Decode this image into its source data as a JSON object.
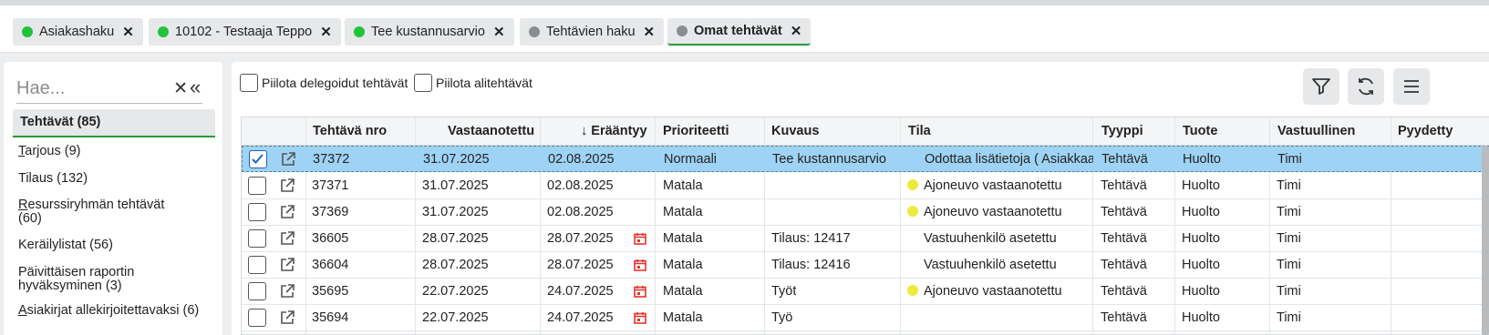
{
  "tabs": [
    {
      "label": "Asiakashaku",
      "dot": "green"
    },
    {
      "label": "10102 - Testaaja Teppo",
      "dot": "green"
    },
    {
      "label": "Tee kustannusarvio",
      "dot": "green"
    },
    {
      "label": "Tehtävien haku",
      "dot": "gray"
    },
    {
      "label": "Omat tehtävät",
      "dot": "gray",
      "active": true
    }
  ],
  "sidebar": {
    "search_placeholder": "Hae...",
    "active_item": "Tehtävät (85)",
    "items": [
      {
        "first": "T",
        "rest": "arjous (9)"
      },
      {
        "first": "",
        "rest": "Tilaus (132)"
      },
      {
        "first": "R",
        "rest": "esurssiryhmän tehtävät (60)"
      },
      {
        "first": "",
        "rest": "Keräilylistat (56)"
      },
      {
        "first": "",
        "rest": "Päivittäisen raportin hyväksyminen (3)"
      },
      {
        "first": "A",
        "rest": "siakirjat allekirjoitettavaksi (6)"
      }
    ]
  },
  "filters": {
    "hide_delegated": "Piilota delegoidut tehtävät",
    "hide_subtasks": "Piilota alitehtävät"
  },
  "table": {
    "headers": {
      "nro": "Tehtävä nro",
      "vastaanotettu": "Vastaanotettu",
      "eraantyy": "↓ Erääntyy",
      "prioriteetti": "Prioriteetti",
      "kuvaus": "Kuvaus",
      "tila": "Tila",
      "tyyppi": "Tyyppi",
      "tuote": "Tuote",
      "vastuullinen": "Vastuullinen",
      "pyydetty": "Pyydetty"
    },
    "rows": [
      {
        "nro": "37372",
        "vastaanotettu": "31.07.2025",
        "eraantyy": "02.08.2025",
        "prioriteetti": "Normaali",
        "kuvaus": "Tee kustannusarvio",
        "tila": "Odottaa lisätietoja ( Asiakkaa",
        "tyyppi": "Tehtävä",
        "tuote": "Huolto",
        "vastuullinen": "Timi"
      },
      {
        "nro": "37371",
        "vastaanotettu": "31.07.2025",
        "eraantyy": "02.08.2025",
        "prioriteetti": "Matala",
        "kuvaus": "",
        "tila": "Ajoneuvo vastaanotettu",
        "tyyppi": "Tehtävä",
        "tuote": "Huolto",
        "vastuullinen": "Timi"
      },
      {
        "nro": "37369",
        "vastaanotettu": "31.07.2025",
        "eraantyy": "02.08.2025",
        "prioriteetti": "Matala",
        "kuvaus": "",
        "tila": "Ajoneuvo vastaanotettu",
        "tyyppi": "Tehtävä",
        "tuote": "Huolto",
        "vastuullinen": "Timi"
      },
      {
        "nro": "36605",
        "vastaanotettu": "28.07.2025",
        "eraantyy": "28.07.2025",
        "prioriteetti": "Matala",
        "kuvaus": "Tilaus: 12417",
        "tila": "Vastuuhenkilö asetettu",
        "tyyppi": "Tehtävä",
        "tuote": "Huolto",
        "vastuullinen": "Timi"
      },
      {
        "nro": "36604",
        "vastaanotettu": "28.07.2025",
        "eraantyy": "28.07.2025",
        "prioriteetti": "Matala",
        "kuvaus": "Tilaus: 12416",
        "tila": "Vastuuhenkilö asetettu",
        "tyyppi": "Tehtävä",
        "tuote": "Huolto",
        "vastuullinen": "Timi"
      },
      {
        "nro": "35695",
        "vastaanotettu": "22.07.2025",
        "eraantyy": "24.07.2025",
        "prioriteetti": "Matala",
        "kuvaus": "Työt",
        "tila": "Ajoneuvo vastaanotettu",
        "tyyppi": "Tehtävä",
        "tuote": "Huolto",
        "vastuullinen": "Timi"
      },
      {
        "nro": "35694",
        "vastaanotettu": "22.07.2025",
        "eraantyy": "24.07.2025",
        "prioriteetti": "Matala",
        "kuvaus": "Työ",
        "tila": "",
        "tyyppi": "Tehtävä",
        "tuote": "Huolto",
        "vastuullinen": "Timi"
      }
    ]
  },
  "colors": {
    "accent_green": "#22c33a",
    "selected_row": "#9fd3f5",
    "status_yellow": "#ecea3a",
    "overdue_red": "#e8322a"
  }
}
